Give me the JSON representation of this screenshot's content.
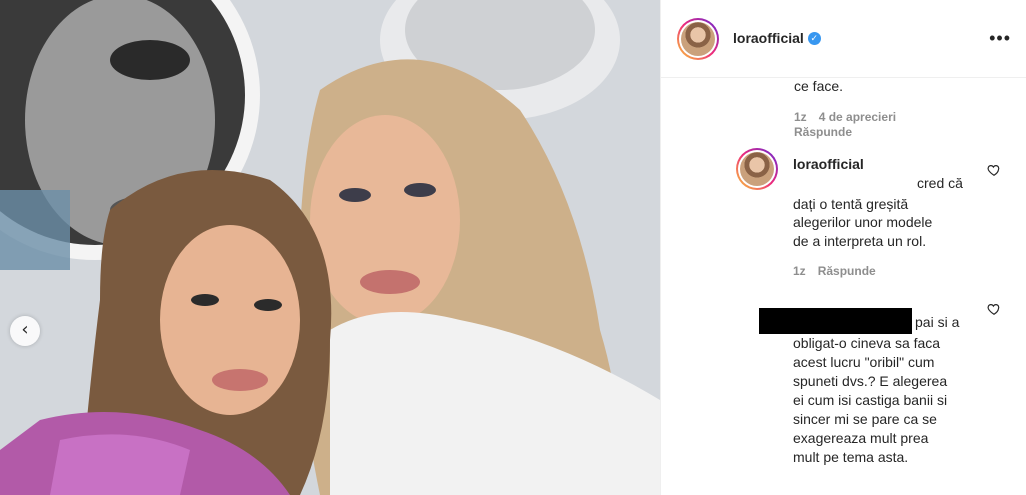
{
  "post": {
    "username": "loraofficial",
    "more_icon": "•••"
  },
  "comments": {
    "first_tail": "ce face.",
    "first_meta": {
      "time": "1z",
      "likes": "4 de aprecieri",
      "reply": "Răspunde"
    },
    "reply": {
      "username": "loraofficial",
      "line1": "cred că",
      "line2": "dați o tentă greșită",
      "line3": "alegerilor unor modele",
      "line4": "de a interpreta un rol.",
      "time": "1z",
      "reply_label": "Răspunde"
    },
    "third": {
      "line1": "pai si a",
      "lines": [
        "obligat-o cineva sa faca",
        "acest lucru \"oribil\" cum",
        "spuneti dvs.? E alegerea",
        "ei cum isi castiga banii si",
        "sincer mi se pare ca se",
        "exagereaza mult prea",
        "mult pe tema asta."
      ]
    }
  },
  "icons": {
    "prev_arrow": "‹",
    "verified": "✓"
  },
  "colors": {
    "verified_blue": "#3897f0",
    "text": "#262626",
    "meta_gray": "#8e8e8e"
  }
}
